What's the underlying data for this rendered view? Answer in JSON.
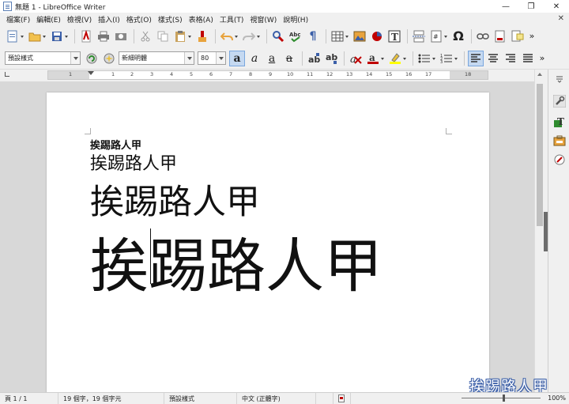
{
  "window": {
    "title": "無題 1 - LibreOffice Writer",
    "minimize": "—",
    "maximize": "❐",
    "close": "✕"
  },
  "menu": [
    "檔案(F)",
    "編輯(E)",
    "檢視(V)",
    "插入(I)",
    "格式(O)",
    "樣式(S)",
    "表格(A)",
    "工具(T)",
    "視窗(W)",
    "說明(H)"
  ],
  "menu_close": "✕",
  "formatting": {
    "paragraph_style": "預設樣式",
    "font_name": "新細明體",
    "font_size": "80"
  },
  "toolbar_icons": {
    "more": "»"
  },
  "ruler": {
    "numbers": [
      "1",
      "1",
      "2",
      "3",
      "4",
      "5",
      "6",
      "7",
      "8",
      "9",
      "10",
      "11",
      "12",
      "13",
      "14",
      "15",
      "16",
      "17",
      "18"
    ]
  },
  "document": {
    "lines": [
      "挨踢路人甲",
      "挨踢路人甲",
      "挨踢路人甲",
      "挨踢路人甲"
    ]
  },
  "watermark": "挨踢路人甲",
  "status": {
    "page": "頁 1 / 1",
    "word_count": "19 個字，19 個字元",
    "page_style": "預設樣式",
    "language": "中文 (正體字)",
    "zoom": "100%"
  },
  "colors": {
    "accent": "#c5d9f1",
    "font_color": "#c00000",
    "highlight": "#ffff00"
  }
}
